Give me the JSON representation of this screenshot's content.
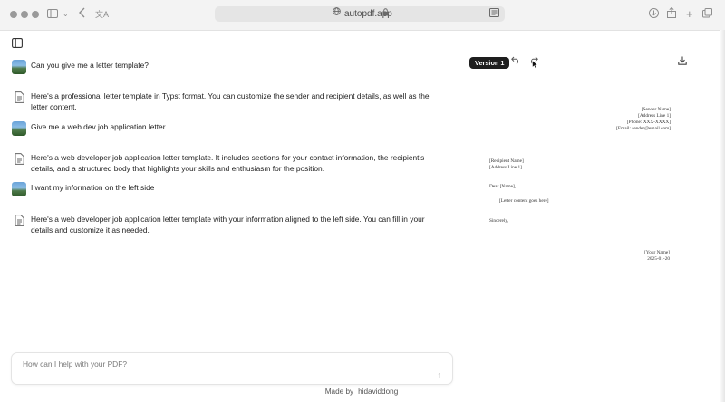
{
  "browser": {
    "url": "autopdf.app"
  },
  "messages": [
    {
      "role": "user",
      "text": "Can you give me a letter template?"
    },
    {
      "role": "assistant",
      "text": "Here's a professional letter template in Typst format. You can customize the sender and recipient details, as well as the letter content."
    },
    {
      "role": "user",
      "text": "Give me a web dev job application letter"
    },
    {
      "role": "assistant",
      "text": "Here's a web developer job application letter template. It includes sections for your contact information, the recipient's details, and a structured body that highlights your skills and enthusiasm for the position."
    },
    {
      "role": "user",
      "text": "I want my information on the left side"
    },
    {
      "role": "assistant",
      "text": "Here's a web developer job application letter template with your information aligned to the left side. You can fill in your details and customize it as needed."
    }
  ],
  "input": {
    "placeholder": "How can I help with your PDF?"
  },
  "footer": {
    "made_by": "Made by",
    "author": "hidaviddong"
  },
  "preview": {
    "version_label": "Version 1",
    "letter": {
      "sender_name": "[Sender Name]",
      "sender_address": "[Address Line 1]",
      "sender_phone": "[Phone: XXX-XXXX]",
      "sender_email": "[Email: sender@email.com]",
      "recipient_name": "[Recipient Name]",
      "recipient_address": "[Address Line 1]",
      "salutation": "Dear [Name],",
      "content": "[Letter content goes here]",
      "closing": "Sincerely,",
      "signature": "[Your Name]",
      "date": "2025-01-20"
    }
  },
  "colors": {
    "badge_bg": "#1e1e1e",
    "chrome_bg": "#f3f3f3"
  }
}
